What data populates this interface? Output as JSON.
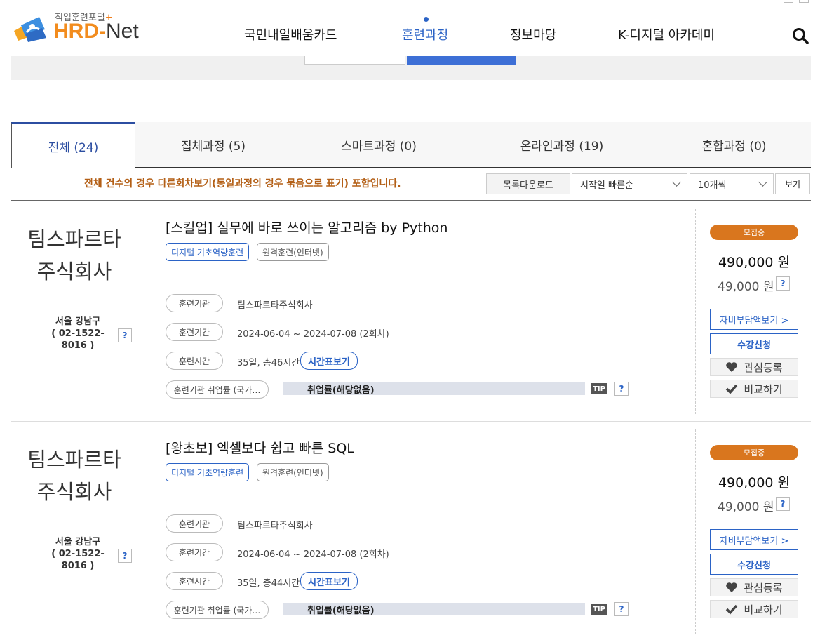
{
  "header": {
    "logo_tag": "직업훈련포털",
    "logo_plus": "+",
    "logo_hrd": "HRD",
    "logo_dash": "-",
    "logo_net": "Net",
    "nav": [
      "국민내일배움카드",
      "훈련과정",
      "정보마당",
      "K-디지털 아카데미"
    ],
    "active_nav": "훈련과정"
  },
  "tabs": [
    {
      "label": "전체 (24)"
    },
    {
      "label": "집체과정 (5)"
    },
    {
      "label": "스마트과정 (0)"
    },
    {
      "label": "온라인과정 (19)"
    },
    {
      "label": "혼합과정 (0)"
    }
  ],
  "toolbar": {
    "notice": "전체 건수의 경우 다른회차보기(동일과정의 경우 묶음으로 표기) 포함입니다.",
    "download_label": "목록다운로드",
    "sort_value": "시작일 빠른순",
    "per_page_value": "10개씩",
    "view_label": "보기"
  },
  "courses": [
    {
      "company_line1": "팀스파르타",
      "company_line2": "주식회사",
      "region": "서울 강남구",
      "phone": "( 02-1522-8016 )",
      "title": "[스킬업] 실무에 바로 쓰이는 알고리즘 by Python",
      "tags": [
        "디지털 기초역량훈련",
        "원격훈련(인터넷)"
      ],
      "labels": {
        "institution": "훈련기관",
        "period": "훈련기간",
        "hours": "훈련시간",
        "employment": "훈련기관 취업률 (국가…"
      },
      "institution": "팀스파르타주식회사",
      "period": "2024-06-04 ~ 2024-07-08 (2회차)",
      "hours": "35일, 총46시간",
      "timetable_label": "시간표보기",
      "employment_rate": "취업률(해당없음)",
      "tip": "TIP",
      "status": "모집중",
      "price": "490,000 원",
      "self_pay": "49,000 원",
      "self_pay_btn": "자비부담액보기 >",
      "apply_btn": "수강신청",
      "wishlist_btn": "관심등록",
      "compare_btn": "비교하기"
    },
    {
      "company_line1": "팀스파르타",
      "company_line2": "주식회사",
      "region": "서울 강남구",
      "phone": "( 02-1522-8016 )",
      "title": "[왕초보] 엑셀보다 쉽고 빠른 SQL",
      "tags": [
        "디지털 기초역량훈련",
        "원격훈련(인터넷)"
      ],
      "labels": {
        "institution": "훈련기관",
        "period": "훈련기간",
        "hours": "훈련시간",
        "employment": "훈련기관 취업률 (국가…"
      },
      "institution": "팀스파르타주식회사",
      "period": "2024-06-04 ~ 2024-07-08 (2회차)",
      "hours": "35일, 총44시간",
      "timetable_label": "시간표보기",
      "employment_rate": "취업률(해당없음)",
      "tip": "TIP",
      "status": "모집중",
      "price": "490,000 원",
      "self_pay": "49,000 원",
      "self_pay_btn": "자비부담액보기 >",
      "apply_btn": "수강신청",
      "wishlist_btn": "관심등록",
      "compare_btn": "비교하기"
    }
  ],
  "help_glyph": "?",
  "colors": {
    "accent": "#2b63c6",
    "brand_orange": "#f28c1e",
    "status_orange": "#d9761e",
    "notice": "#b35f16"
  }
}
